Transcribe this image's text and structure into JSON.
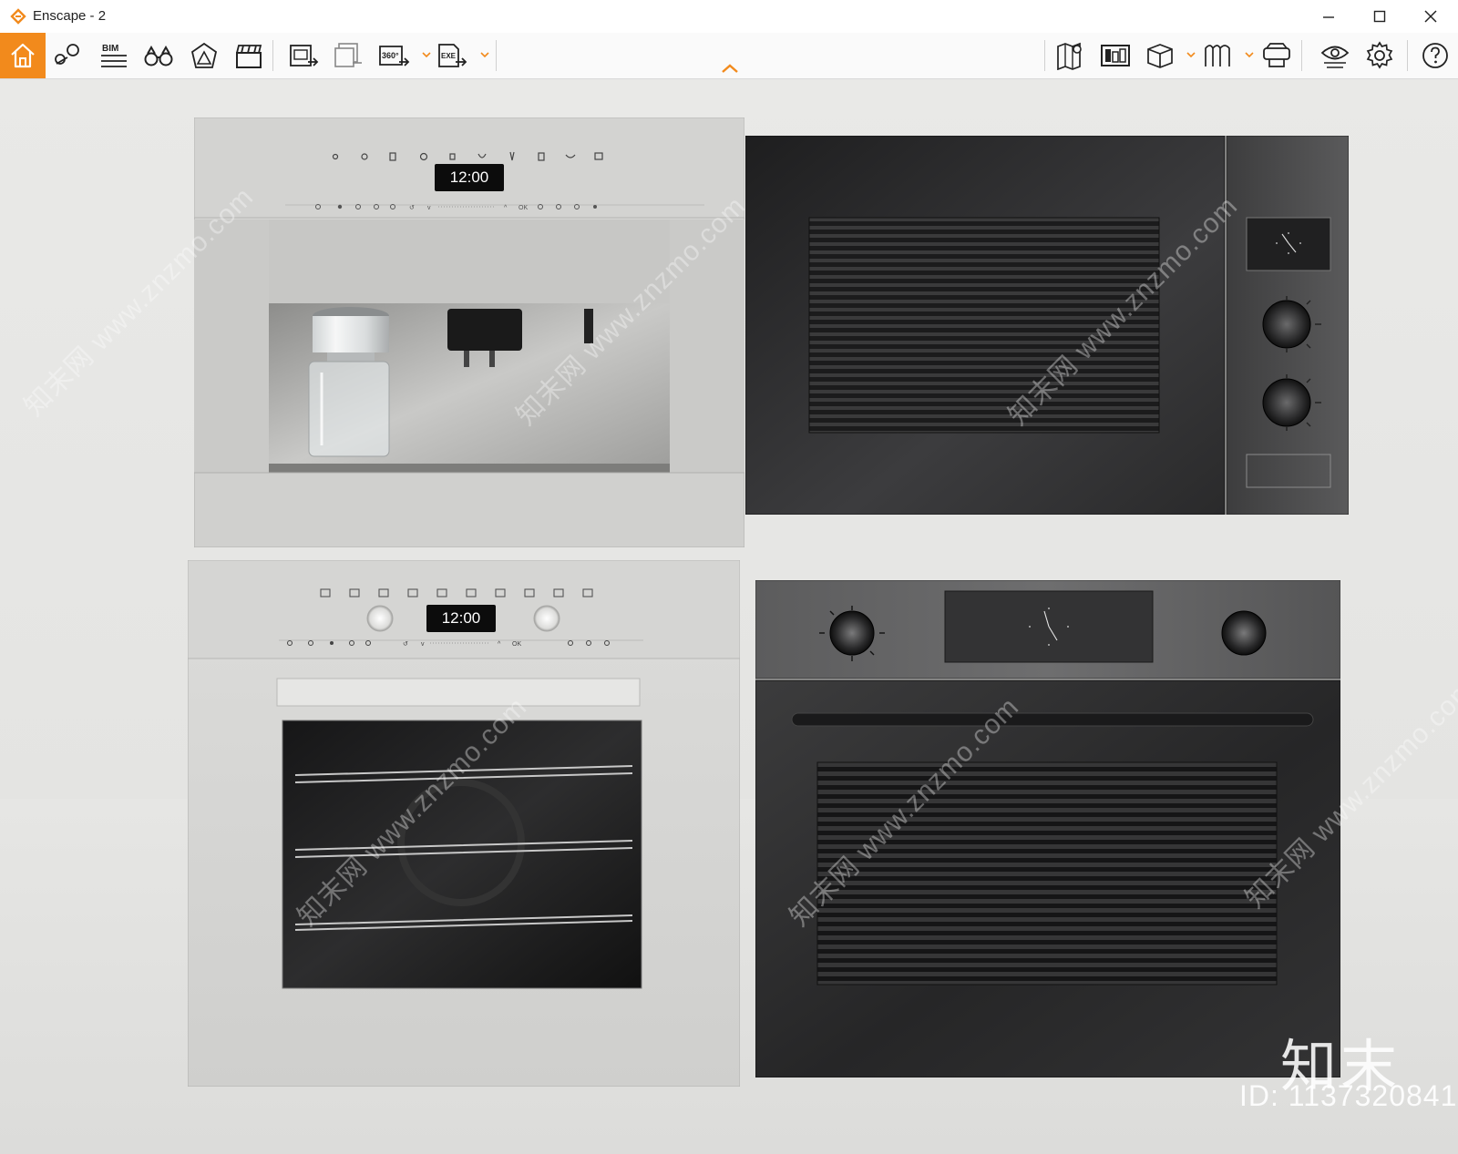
{
  "window": {
    "title": "Enscape - 2",
    "controls": {
      "minimize": "minimize-icon",
      "maximize": "maximize-icon",
      "close": "close-icon"
    }
  },
  "toolbar": {
    "accent_color": "#f28a1c",
    "left_tools": [
      {
        "name": "home",
        "icon": "home-icon"
      },
      {
        "name": "views",
        "icon": "pin-views-icon"
      },
      {
        "name": "bim",
        "icon": "bim-icon",
        "label": "BIM"
      },
      {
        "name": "explore",
        "icon": "binoculars-icon"
      },
      {
        "name": "atmosphere",
        "icon": "atmosphere-icon"
      },
      {
        "name": "video",
        "icon": "clapperboard-icon"
      },
      {
        "name": "render-image",
        "icon": "render-image-icon"
      },
      {
        "name": "batch-render",
        "icon": "batch-render-icon"
      },
      {
        "name": "panorama",
        "icon": "panorama-360-icon",
        "label": "360°"
      },
      {
        "name": "export",
        "icon": "exe-export-icon",
        "label": "EXE"
      }
    ],
    "right_tools": [
      {
        "name": "map",
        "icon": "map-icon"
      },
      {
        "name": "asset-library",
        "icon": "asset-library-icon"
      },
      {
        "name": "cube-view",
        "icon": "cube-icon"
      },
      {
        "name": "material",
        "icon": "material-icon"
      },
      {
        "name": "vr",
        "icon": "vr-headset-icon"
      },
      {
        "name": "visual-settings",
        "icon": "eye-settings-icon"
      },
      {
        "name": "settings",
        "icon": "gear-icon"
      },
      {
        "name": "help",
        "icon": "help-icon"
      }
    ]
  },
  "scene": {
    "coffee_machine_display": "12:00",
    "oven_display": "12:00",
    "watermark_site": "www.znzmo.com",
    "watermark_brand": "知末网",
    "logo_text": "知末",
    "image_id": "ID: 1137320841"
  }
}
